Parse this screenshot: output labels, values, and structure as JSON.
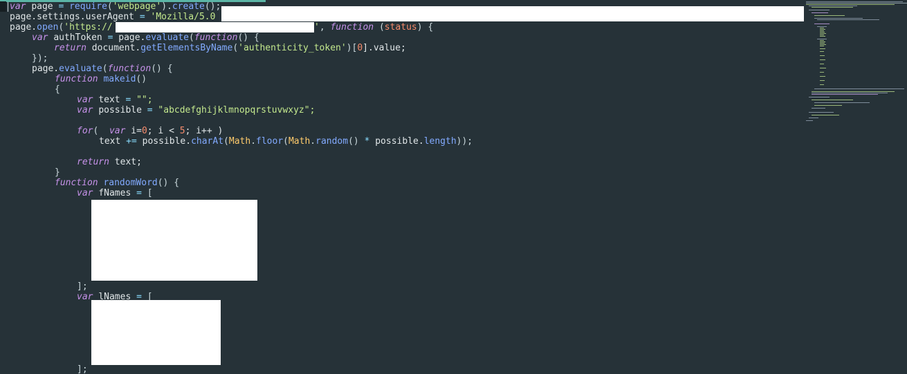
{
  "editor": {
    "theme": "dark",
    "accent_color": "#5bb5a6",
    "background_color": "#263238",
    "code": {
      "l1": [
        "var",
        "page",
        "=",
        "require",
        "(",
        "'webpage'",
        ").",
        "create",
        "();"
      ],
      "l2": [
        "page.settings.userAgent",
        "=",
        "'Mozilla/5.0"
      ],
      "l3": [
        "page.",
        "open",
        "(",
        "'https://",
        "'",
        ",",
        "function",
        "(",
        "status",
        ")",
        "{"
      ],
      "l4": [
        "var",
        "authToken",
        "=",
        "page.",
        "evaluate",
        "(",
        "function",
        "()",
        "{"
      ],
      "l5": [
        "return",
        "document.",
        "getElementsByName",
        "(",
        "'authenticity_token'",
        ")[",
        "0",
        "].value;"
      ],
      "l6": [
        "});"
      ],
      "l7": [
        "page.",
        "evaluate",
        "(",
        "function",
        "()",
        "{"
      ],
      "l8": [
        "function",
        "makeid",
        "()"
      ],
      "l9": [
        "{"
      ],
      "l10": [
        "var",
        "text",
        "=",
        "\"\";"
      ],
      "l11": [
        "var",
        "possible",
        "=",
        "\"abcdefghijklmnopqrstuvwxyz\";"
      ],
      "l12": [
        "for",
        "(",
        "var",
        "i=",
        "0",
        "; i <",
        "5",
        "; i++ )"
      ],
      "l13": [
        "text",
        "+=",
        "possible.",
        "charAt",
        "(",
        "Math",
        ".",
        "floor",
        "(",
        "Math",
        ".",
        "random",
        "()",
        "*",
        "possible.",
        "length",
        "));"
      ],
      "l14": [
        "return",
        "text;"
      ],
      "l15": [
        "}"
      ],
      "l16": [
        "function",
        "randomWord",
        "()",
        "{"
      ],
      "l17": [
        "var",
        "fNames",
        "=",
        "["
      ],
      "l18": [
        "];"
      ],
      "l19": [
        "var",
        "lNames",
        "=",
        "["
      ],
      "l20": [
        "];"
      ]
    }
  }
}
